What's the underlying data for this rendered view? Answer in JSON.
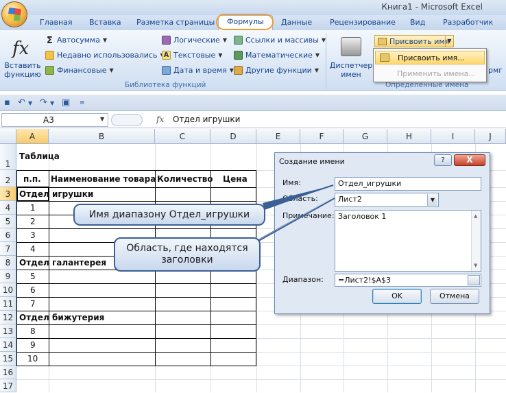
{
  "window": {
    "title": "Книга1 - Microsoft Excel"
  },
  "tabs": [
    "Главная",
    "Вставка",
    "Разметка страницы",
    "Формулы",
    "Данные",
    "Рецензирование",
    "Вид",
    "Разработчик"
  ],
  "ribbon": {
    "insert_function_label_1": "Вставить",
    "insert_function_label_2": "функцию",
    "library_items": {
      "autosum": "Автосумма",
      "recent": "Недавно использовались",
      "financial": "Финансовые",
      "logical": "Логические",
      "text": "Текстовые",
      "datetime": "Дата и время",
      "lookup": "Ссылки и массивы",
      "math": "Математические",
      "other": "Другие функции"
    },
    "library_group": "Библиотека функций",
    "manager_label_1": "Диспетчер",
    "manager_label_2": "имен",
    "assign_name_btn": "Присвоить имя",
    "defined_names_group": "Определенные имена",
    "cut_off_label": "рмг",
    "dropdown": {
      "assign": "Присвоить имя...",
      "apply": "Применить имена..."
    }
  },
  "formula_bar": {
    "name_box": "A3",
    "fx": "fx",
    "value": "Отдел игрушки"
  },
  "columns": [
    "A",
    "B",
    "C",
    "D",
    "E",
    "F",
    "G",
    "H",
    "I",
    "J"
  ],
  "rows": [
    "1",
    "2",
    "3",
    "4",
    "5",
    "6",
    "7",
    "8",
    "9",
    "10",
    "11",
    "12",
    "13",
    "14",
    "15",
    "16",
    "17"
  ],
  "sheet": {
    "title": "Таблица",
    "headers": {
      "num": "п.п.",
      "name": "Наименование товара",
      "qty": "Количество",
      "price": "Цена"
    },
    "section_toys": "Отдел игрушки",
    "section_haberdashery": "Отдел галантерея",
    "section_jewelry": "Отдел бижутерия",
    "nums": [
      "1",
      "2",
      "3",
      "4",
      "5",
      "6",
      "7",
      "8",
      "9",
      "10"
    ]
  },
  "dialog": {
    "title": "Создание имени",
    "help": "?",
    "close": "X",
    "name_label": "Имя:",
    "name_value": "Отдел_игрушки",
    "scope_label": "Область:",
    "scope_value": "Лист2",
    "comment_label": "Примечание:",
    "comment_value": "Заголовок 1",
    "range_label": "Диапазон:",
    "range_value": "=Лист2!$A$3",
    "ok": "OK",
    "cancel": "Отмена"
  },
  "callouts": {
    "range_name": "Имя диапазону Отдел_игрушки",
    "scope": "Область, где находятся заголовки"
  }
}
